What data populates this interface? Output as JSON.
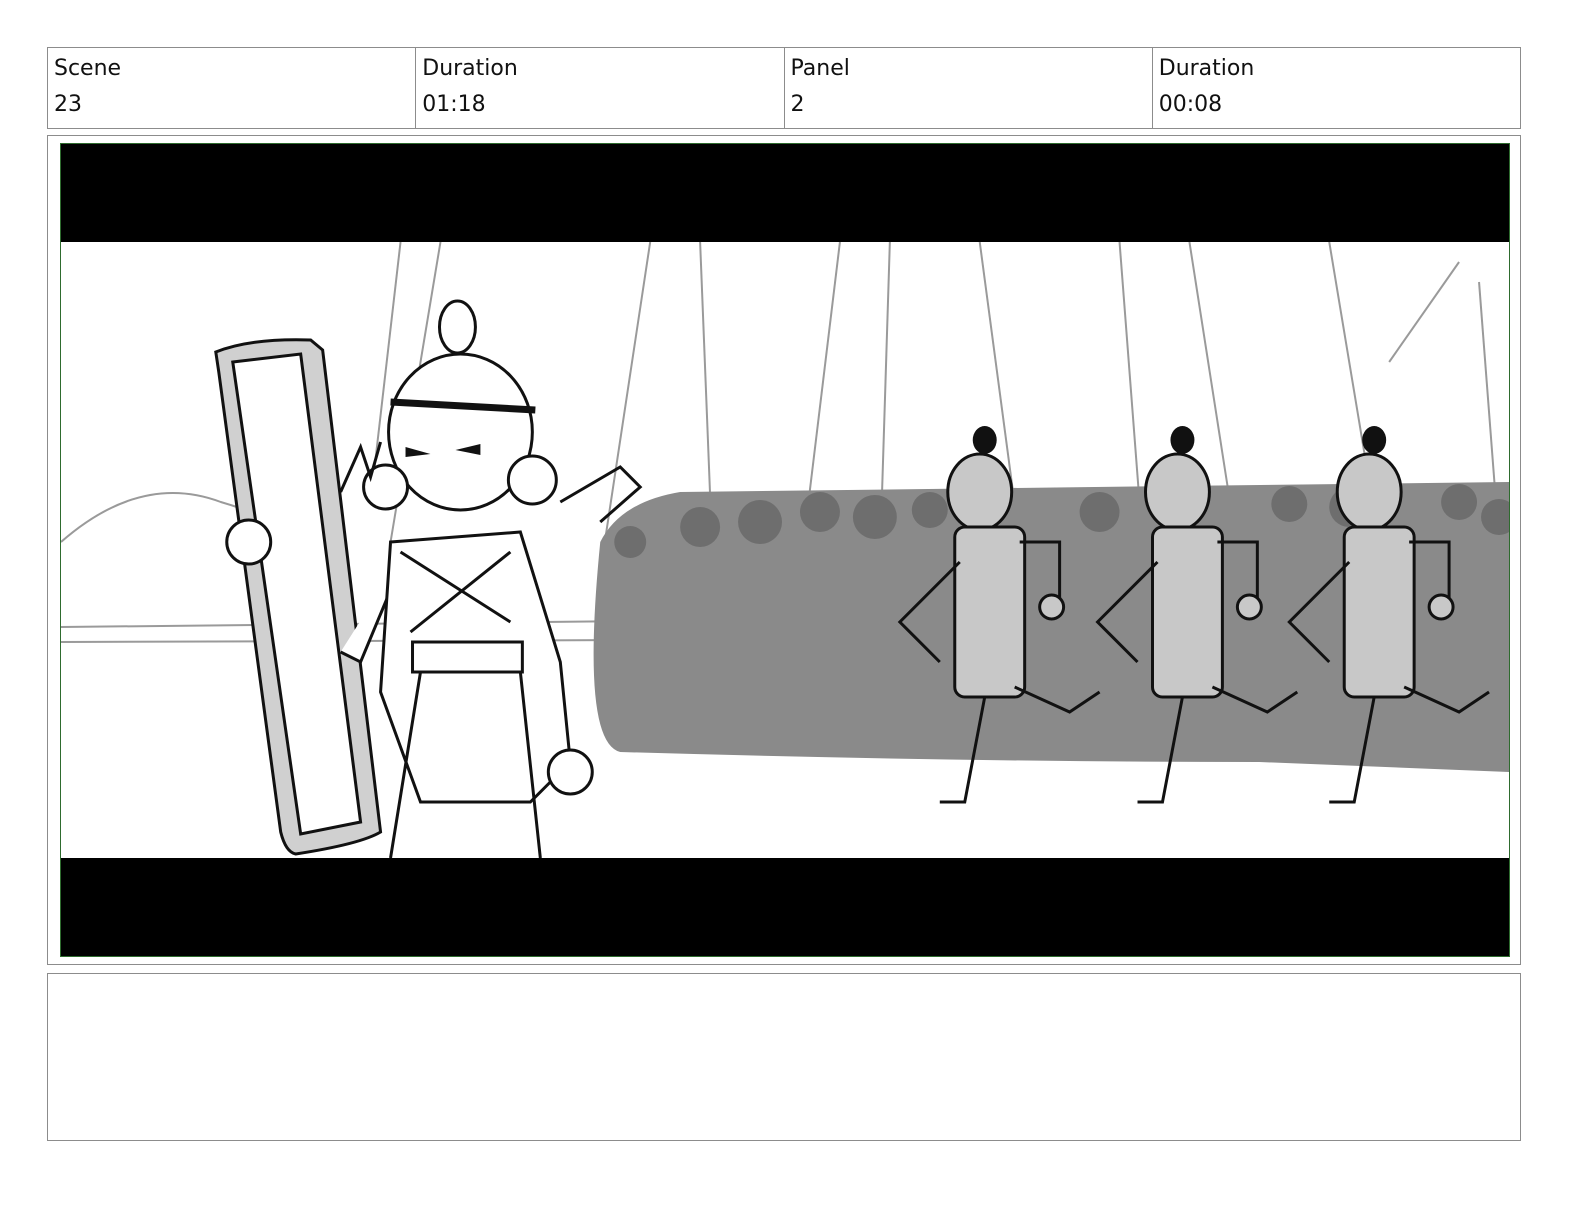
{
  "header": {
    "scene_label": "Scene",
    "scene_value": "23",
    "duration_label": "Duration",
    "duration_value": "01:18",
    "panel_label": "Panel",
    "panel_value": "2",
    "panel_duration_label": "Duration",
    "panel_duration_value": "00:08"
  },
  "panel_image": {
    "icon": "storyboard-sketch-image"
  },
  "notes": {
    "text": ""
  },
  "colors": {
    "border": "#8c8c8c",
    "frame_border": "#2e6b2e",
    "letterbox": "#000000"
  }
}
